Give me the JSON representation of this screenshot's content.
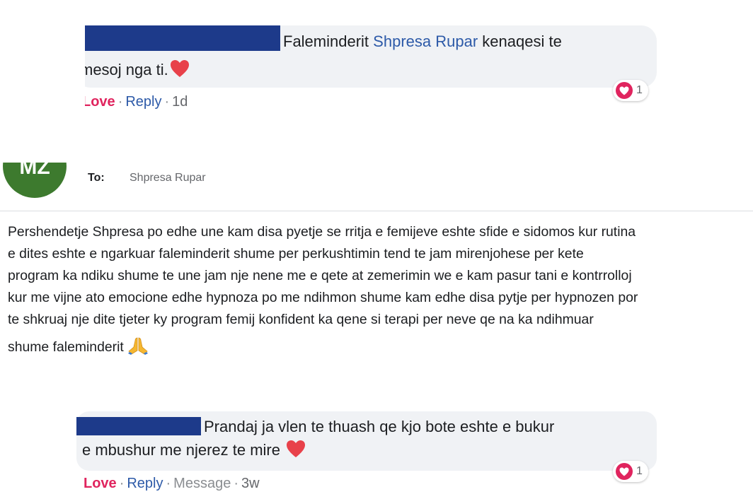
{
  "comment1": {
    "text_before": "Faleminderit",
    "mention": "Shpresa Rupar",
    "text_after": "kenaqesi te",
    "line2": "mesoj nga ti.",
    "actions": {
      "love": "Love",
      "reply": "Reply",
      "time": "1d"
    },
    "reaction_count": "1"
  },
  "message": {
    "avatar_initials": "MZ",
    "to_label": "To:",
    "to_name": "Shpresa Rupar",
    "lines": [
      "Pershendetje Shpresa po edhe une kam disa pyetje se rritja e femijeve eshte sfide e sidomos kur rutina",
      "e dites eshte e ngarkuar  faleminderit shume per perkushtimin tend te jam mirenjohese per kete",
      "program ka ndiku shume te une jam nje nene me e qete at zemerimin we e kam pasur tani e kontrrolloj",
      "kur me vijne ato emocione edhe hypnoza po me ndihmon shume kam edhe disa pytje per hypnozen por",
      "te shkruaj nje dite tjeter ky program femij konfident ka qene si terapi per neve qe na ka ndihmuar"
    ],
    "last_line": "shume faleminderit"
  },
  "comment2": {
    "line1": "Prandaj ja vlen te thuash qe kjo bote eshte e bukur",
    "line2": "e mbushur me njerez te mire",
    "actions": {
      "love": "Love",
      "reply": "Reply",
      "message": "Message",
      "time": "3w"
    },
    "reaction_count": "1"
  },
  "colors": {
    "love": "#e0245e",
    "link": "#2d5aa8",
    "redaction": "#1d3a8a",
    "avatar": "#3d7a2e"
  },
  "icons": [
    "heart-icon",
    "pray-hands-icon"
  ]
}
